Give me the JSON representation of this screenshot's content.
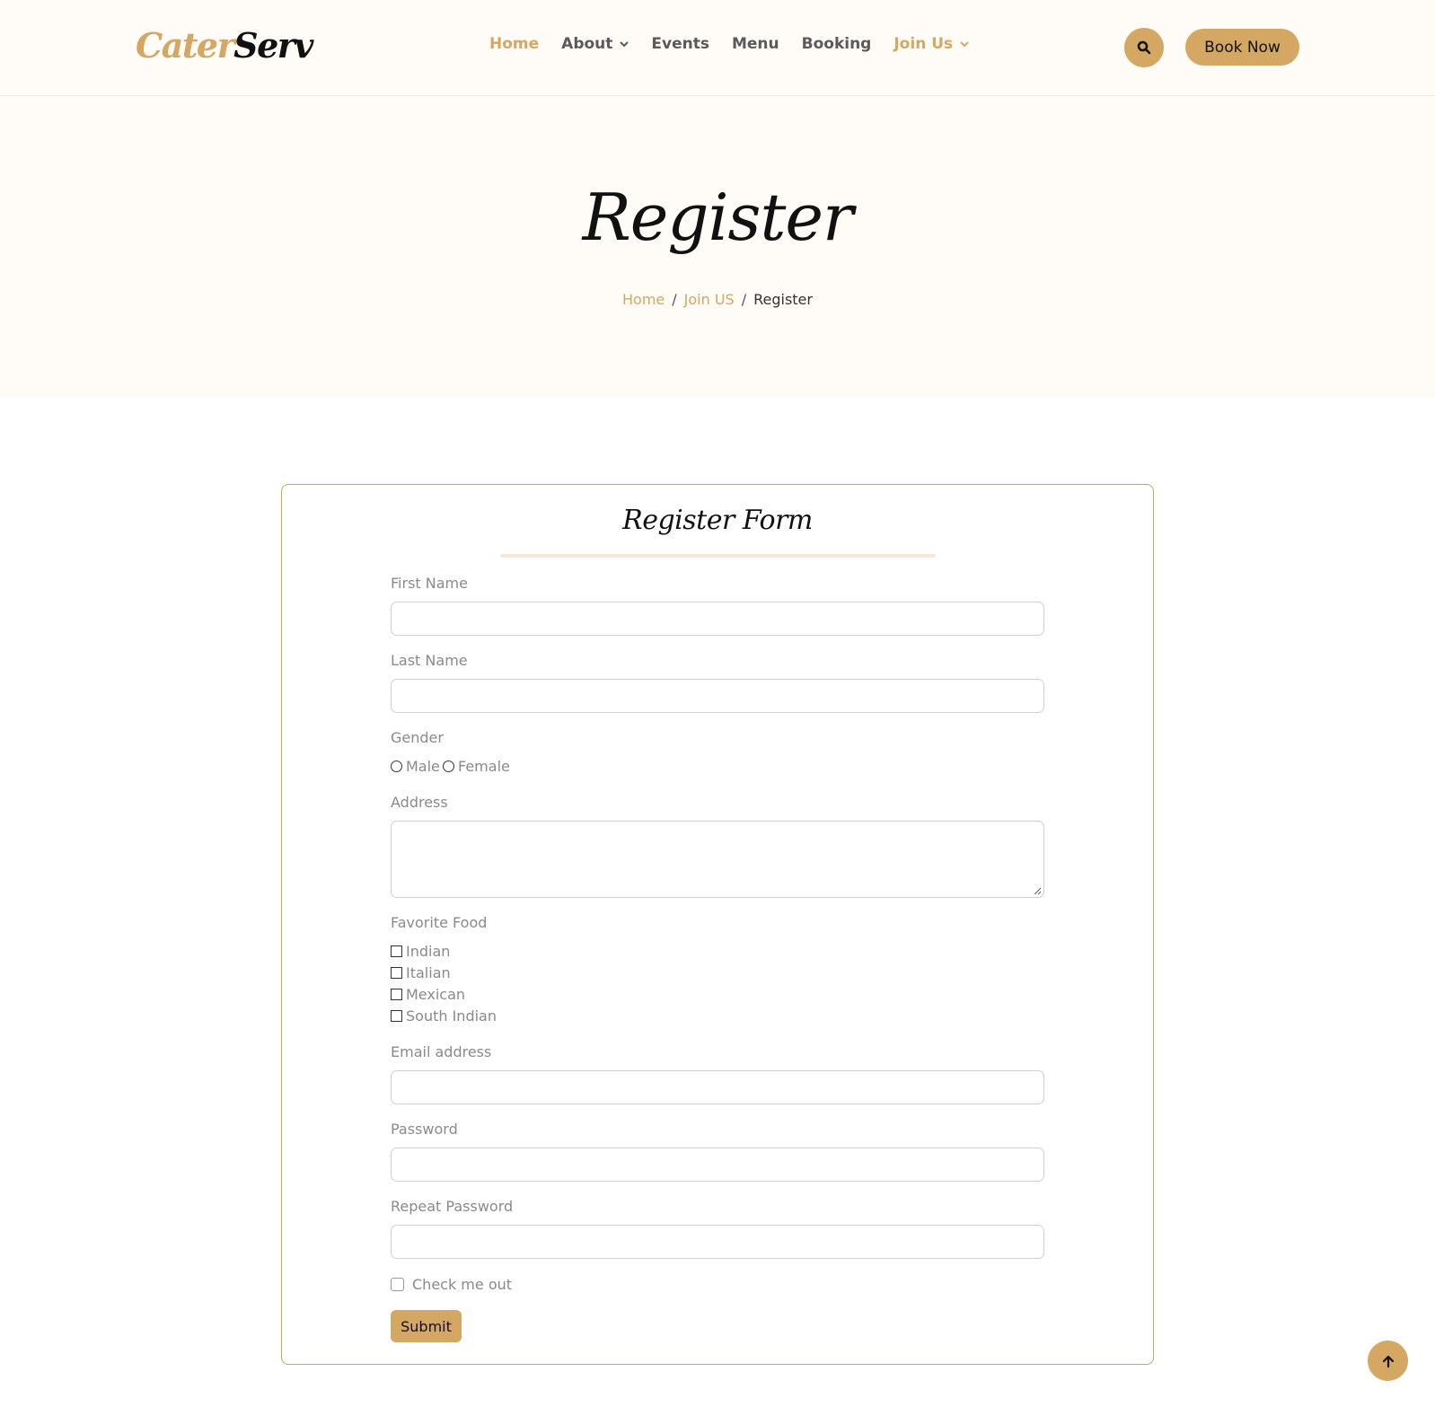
{
  "brand": {
    "part1": "Cater",
    "part2": "Serv"
  },
  "nav": {
    "items": [
      {
        "label": "Home"
      },
      {
        "label": "About"
      },
      {
        "label": "Events"
      },
      {
        "label": "Menu"
      },
      {
        "label": "Booking"
      },
      {
        "label": "Join Us"
      }
    ],
    "book_label": "Book Now"
  },
  "hero": {
    "title": "Register",
    "breadcrumb": [
      "Home",
      "Join US",
      "Register"
    ],
    "separator": "/"
  },
  "form": {
    "title": "Register Form",
    "first_name_label": "First Name",
    "last_name_label": "Last Name",
    "gender_label": "Gender",
    "gender_options": [
      "Male",
      "Female"
    ],
    "address_label": "Address",
    "food_label": "Favorite Food",
    "food_options": [
      "Indian",
      "Italian",
      "Mexican",
      "South Indian"
    ],
    "email_label": "Email address",
    "password_label": "Password",
    "repeat_password_label": "Repeat Password",
    "check_label": "Check me out",
    "submit_label": "Submit"
  },
  "colors": {
    "accent": "#d4a762",
    "hero_bg": "#fffbf6",
    "card_border": "#c9a46a"
  },
  "icons": {
    "search": "search-icon",
    "back_to_top": "arrow-up-icon",
    "dropdown": "chevron-down-icon"
  }
}
